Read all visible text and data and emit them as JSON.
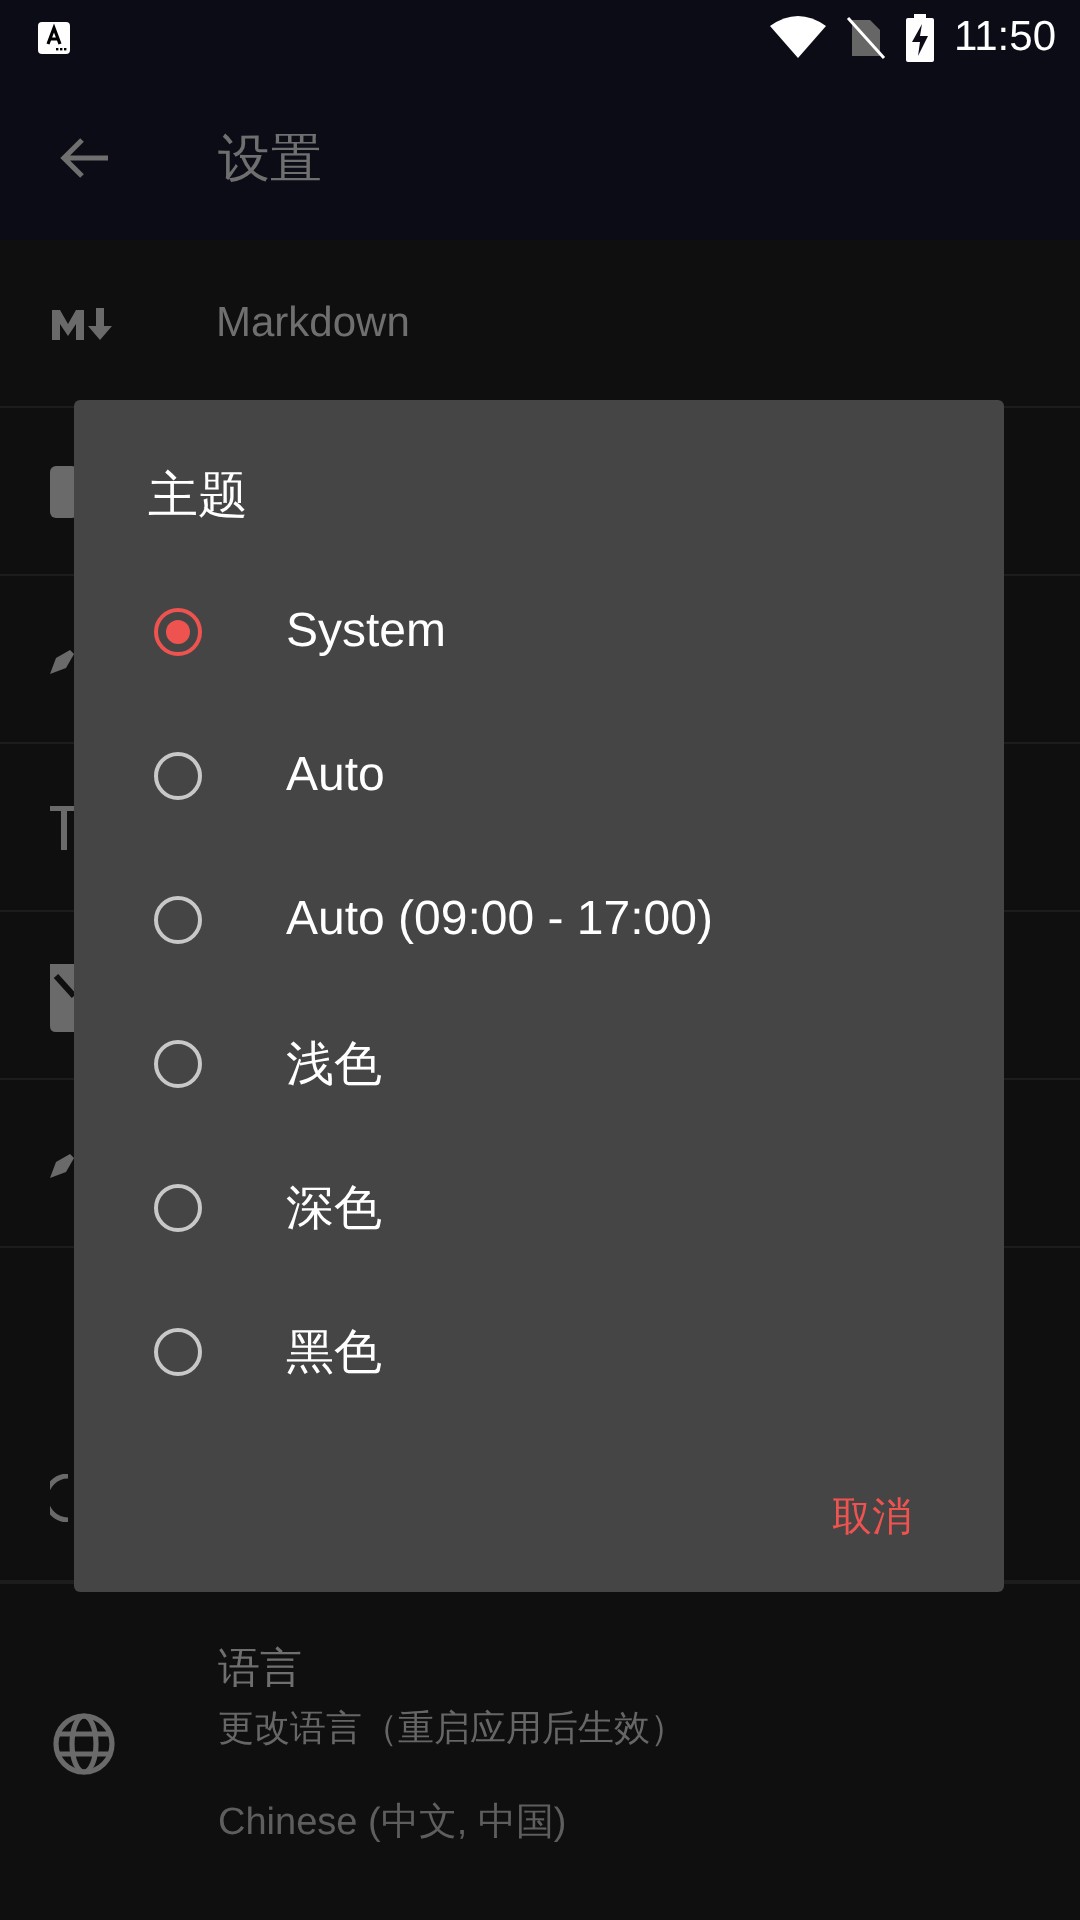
{
  "status_bar": {
    "time": "11:50"
  },
  "app_bar": {
    "title": "设置"
  },
  "settings": {
    "markdown_label": "Markdown",
    "language": {
      "title": "语言",
      "summary": "更改语言（重启应用后生效）",
      "value": "Chinese (中文, 中国)"
    }
  },
  "dialog": {
    "title": "主题",
    "options": [
      {
        "label": "System",
        "selected": true
      },
      {
        "label": "Auto",
        "selected": false
      },
      {
        "label": "Auto (09:00 - 17:00)",
        "selected": false
      },
      {
        "label": "浅色",
        "selected": false
      },
      {
        "label": "深色",
        "selected": false
      },
      {
        "label": "黑色",
        "selected": false
      }
    ],
    "buttons": [
      "取消"
    ]
  }
}
